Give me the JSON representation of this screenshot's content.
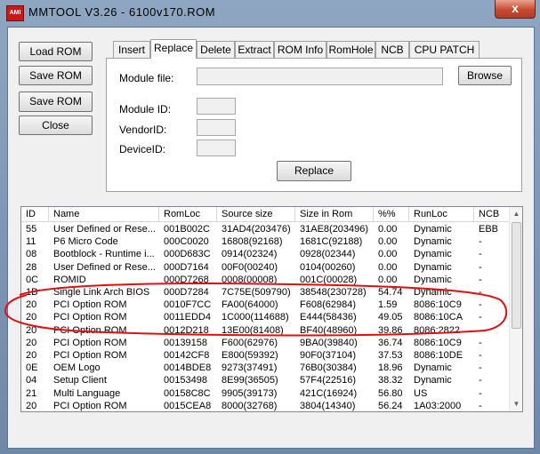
{
  "window": {
    "title": "MMTOOL V3.26 - 6100v170.ROM",
    "app_icon_text": "AMI",
    "close_symbol": "x"
  },
  "side_buttons": [
    "Load ROM",
    "Save ROM",
    "Save ROM as..",
    "Close"
  ],
  "tabs": {
    "items": [
      "Insert",
      "Replace",
      "Delete",
      "Extract",
      "ROM Info",
      "RomHole",
      "NCB",
      "CPU PATCH"
    ],
    "active": "Replace"
  },
  "replace_panel": {
    "module_file_label": "Module file:",
    "module_file_value": "",
    "browse_label": "Browse",
    "module_id_label": "Module ID:",
    "vendor_id_label": "VendorID:",
    "device_id_label": "DeviceID:",
    "replace_label": "Replace"
  },
  "table": {
    "columns": [
      "ID",
      "Name",
      "RomLoc",
      "Source size",
      "Size in Rom",
      "%%",
      "RunLoc",
      "NCB"
    ],
    "rows": [
      [
        "55",
        "User Defined or Rese...",
        "001B002C",
        "31AD4(203476)",
        "31AE8(203496)",
        "0.00",
        "Dynamic",
        "EBB"
      ],
      [
        "11",
        "P6 Micro Code",
        "000C0020",
        "16808(92168)",
        "1681C(92188)",
        "0.00",
        "Dynamic",
        "-"
      ],
      [
        "08",
        "Bootblock - Runtime i...",
        "000D683C",
        "0914(02324)",
        "0928(02344)",
        "0.00",
        "Dynamic",
        "-"
      ],
      [
        "28",
        "User Defined or Rese...",
        "000D7164",
        "00F0(00240)",
        "0104(00260)",
        "0.00",
        "Dynamic",
        "-"
      ],
      [
        "0C",
        "ROMID",
        "000D7268",
        "0008(00008)",
        "001C(00028)",
        "0.00",
        "Dynamic",
        "-"
      ],
      [
        "1B",
        "Single Link Arch BIOS",
        "000D7284",
        "7C75E(509790)",
        "38548(230728)",
        "54.74",
        "Dynamic",
        "-"
      ],
      [
        "20",
        "PCI Option ROM",
        "0010F7CC",
        "FA00(64000)",
        "F608(62984)",
        "1.59",
        "8086:10C9",
        "-"
      ],
      [
        "20",
        "PCI Option ROM",
        "0011EDD4",
        "1C000(114688)",
        "E444(58436)",
        "49.05",
        "8086:10CA",
        "-"
      ],
      [
        "20",
        "PCI Option ROM",
        "0012D218",
        "13E00(81408)",
        "BF40(48960)",
        "39.86",
        "8086:2822",
        "-"
      ],
      [
        "20",
        "PCI Option ROM",
        "00139158",
        "F600(62976)",
        "9BA0(39840)",
        "36.74",
        "8086:10C9",
        "-"
      ],
      [
        "20",
        "PCI Option ROM",
        "00142CF8",
        "E800(59392)",
        "90F0(37104)",
        "37.53",
        "8086:10DE",
        "-"
      ],
      [
        "0E",
        "OEM Logo",
        "0014BDE8",
        "9273(37491)",
        "76B0(30384)",
        "18.96",
        "Dynamic",
        "-"
      ],
      [
        "04",
        "Setup Client",
        "00153498",
        "8E99(36505)",
        "57F4(22516)",
        "38.32",
        "Dynamic",
        "-"
      ],
      [
        "21",
        "Multi Language",
        "00158C8C",
        "9905(39173)",
        "421C(16924)",
        "56.80",
        "US",
        "-"
      ],
      [
        "20",
        "PCI Option ROM",
        "0015CEA8",
        "8000(32768)",
        "3804(14340)",
        "56.24",
        "1A03:2000",
        "-"
      ]
    ]
  },
  "colors": {
    "titlebar_top": "#8fa6c2",
    "client_bg": "#f0f0f0",
    "highlight_ellipse": "#e01010",
    "close_button": "#c74a31"
  },
  "icons": {
    "scroll_up": "▲",
    "scroll_down": "▼"
  }
}
